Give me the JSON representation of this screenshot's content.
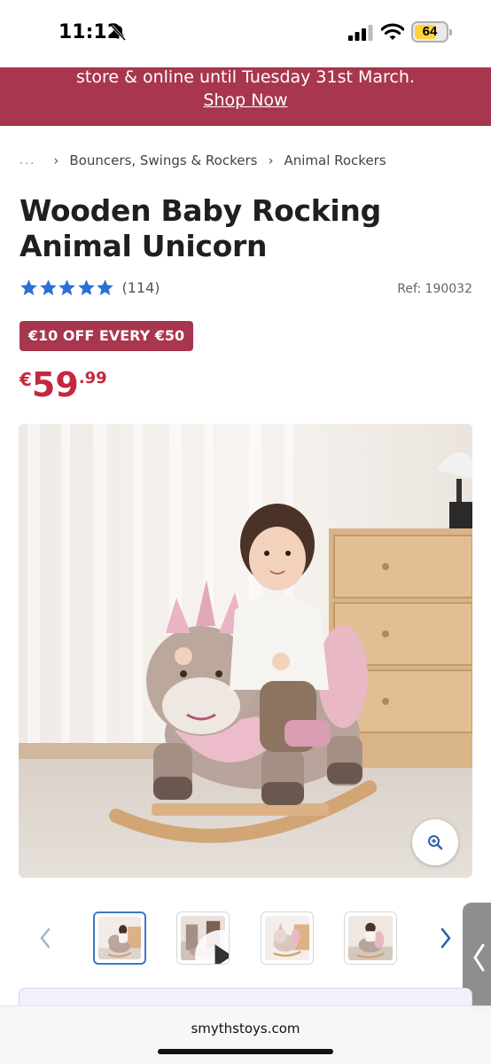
{
  "status_bar": {
    "time": "11:12",
    "battery_level": "64",
    "icons": [
      "bell-muted-icon",
      "signal-icon",
      "wifi-icon",
      "battery-icon"
    ]
  },
  "promo_banner": {
    "text": "store & online until Tuesday 31st March.",
    "link_label": "Shop Now",
    "color": "#a8364e"
  },
  "breadcrumb": {
    "ellipsis": "...",
    "items": [
      "Bouncers, Swings & Rockers",
      "Animal Rockers"
    ]
  },
  "product": {
    "title": "Wooden Baby Rocking Animal Unicorn",
    "rating": 5,
    "review_count": "(114)",
    "ref": "Ref: 190032",
    "offer_badge": "€10 OFF EVERY €50",
    "price": {
      "currency": "€",
      "main": "59",
      "cents": ".99",
      "color": "#c4283c"
    },
    "star_color": "#2d6fd3"
  },
  "gallery": {
    "thumbnail_count": 4,
    "active_index": 0,
    "thumbnails": [
      {
        "kind": "image",
        "active": true
      },
      {
        "kind": "video",
        "active": false
      },
      {
        "kind": "image",
        "active": false
      },
      {
        "kind": "image",
        "active": false
      }
    ]
  },
  "browser": {
    "url": "smythstoys.com"
  }
}
